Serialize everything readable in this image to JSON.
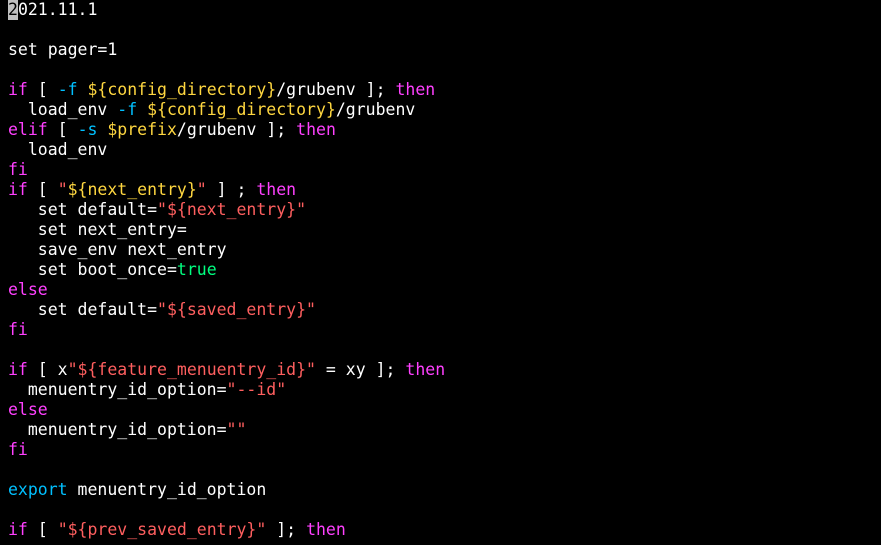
{
  "theme": {
    "background": "#000000",
    "text": "#ffffff",
    "keyword": "#ff40ff",
    "builtin": "#00c0ff",
    "variable": "#ffd740",
    "string": "#ff5f5f",
    "boolean": "#00ff80",
    "cursor": "#c0c0c0"
  },
  "editor": {
    "cursor_char": "2",
    "lines": [
      [
        {
          "t": "021.11.1",
          "c": "text"
        }
      ],
      [],
      [
        {
          "t": "set pager=1",
          "c": "text"
        }
      ],
      [],
      [
        {
          "t": "if",
          "c": "keyword"
        },
        {
          "t": " [ ",
          "c": "text"
        },
        {
          "t": "-f",
          "c": "builtin"
        },
        {
          "t": " ",
          "c": "text"
        },
        {
          "t": "${config_directory}",
          "c": "variable"
        },
        {
          "t": "/grubenv ]; ",
          "c": "text"
        },
        {
          "t": "then",
          "c": "keyword"
        }
      ],
      [
        {
          "t": "  load_env ",
          "c": "text"
        },
        {
          "t": "-f",
          "c": "builtin"
        },
        {
          "t": " ",
          "c": "text"
        },
        {
          "t": "${config_directory}",
          "c": "variable"
        },
        {
          "t": "/grubenv",
          "c": "text"
        }
      ],
      [
        {
          "t": "elif",
          "c": "keyword"
        },
        {
          "t": " [ ",
          "c": "text"
        },
        {
          "t": "-s",
          "c": "builtin"
        },
        {
          "t": " ",
          "c": "text"
        },
        {
          "t": "$prefix",
          "c": "variable"
        },
        {
          "t": "/grubenv ]; ",
          "c": "text"
        },
        {
          "t": "then",
          "c": "keyword"
        }
      ],
      [
        {
          "t": "  load_env",
          "c": "text"
        }
      ],
      [
        {
          "t": "fi",
          "c": "keyword"
        }
      ],
      [
        {
          "t": "if",
          "c": "keyword"
        },
        {
          "t": " [ ",
          "c": "text"
        },
        {
          "t": "\"",
          "c": "string"
        },
        {
          "t": "${next_entry}",
          "c": "variable"
        },
        {
          "t": "\"",
          "c": "string"
        },
        {
          "t": " ] ; ",
          "c": "text"
        },
        {
          "t": "then",
          "c": "keyword"
        }
      ],
      [
        {
          "t": "   set default=",
          "c": "text"
        },
        {
          "t": "\"${next_entry}\"",
          "c": "string"
        }
      ],
      [
        {
          "t": "   set next_entry=",
          "c": "text"
        }
      ],
      [
        {
          "t": "   save_env next_entry",
          "c": "text"
        }
      ],
      [
        {
          "t": "   set boot_once=",
          "c": "text"
        },
        {
          "t": "true",
          "c": "boolean"
        }
      ],
      [
        {
          "t": "else",
          "c": "keyword"
        }
      ],
      [
        {
          "t": "   set default=",
          "c": "text"
        },
        {
          "t": "\"${saved_entry}\"",
          "c": "string"
        }
      ],
      [
        {
          "t": "fi",
          "c": "keyword"
        }
      ],
      [],
      [
        {
          "t": "if",
          "c": "keyword"
        },
        {
          "t": " [ x",
          "c": "text"
        },
        {
          "t": "\"${feature_menuentry_id}\"",
          "c": "string"
        },
        {
          "t": " = xy ]; ",
          "c": "text"
        },
        {
          "t": "then",
          "c": "keyword"
        }
      ],
      [
        {
          "t": "  menuentry_id_option=",
          "c": "text"
        },
        {
          "t": "\"--id\"",
          "c": "string"
        }
      ],
      [
        {
          "t": "else",
          "c": "keyword"
        }
      ],
      [
        {
          "t": "  menuentry_id_option=",
          "c": "text"
        },
        {
          "t": "\"\"",
          "c": "string"
        }
      ],
      [
        {
          "t": "fi",
          "c": "keyword"
        }
      ],
      [],
      [
        {
          "t": "export",
          "c": "builtin"
        },
        {
          "t": " menuentry_id_option",
          "c": "text"
        }
      ],
      [],
      [
        {
          "t": "if",
          "c": "keyword"
        },
        {
          "t": " [ ",
          "c": "text"
        },
        {
          "t": "\"${prev_saved_entry}\"",
          "c": "string"
        },
        {
          "t": " ]; ",
          "c": "text"
        },
        {
          "t": "then",
          "c": "keyword"
        }
      ]
    ]
  }
}
